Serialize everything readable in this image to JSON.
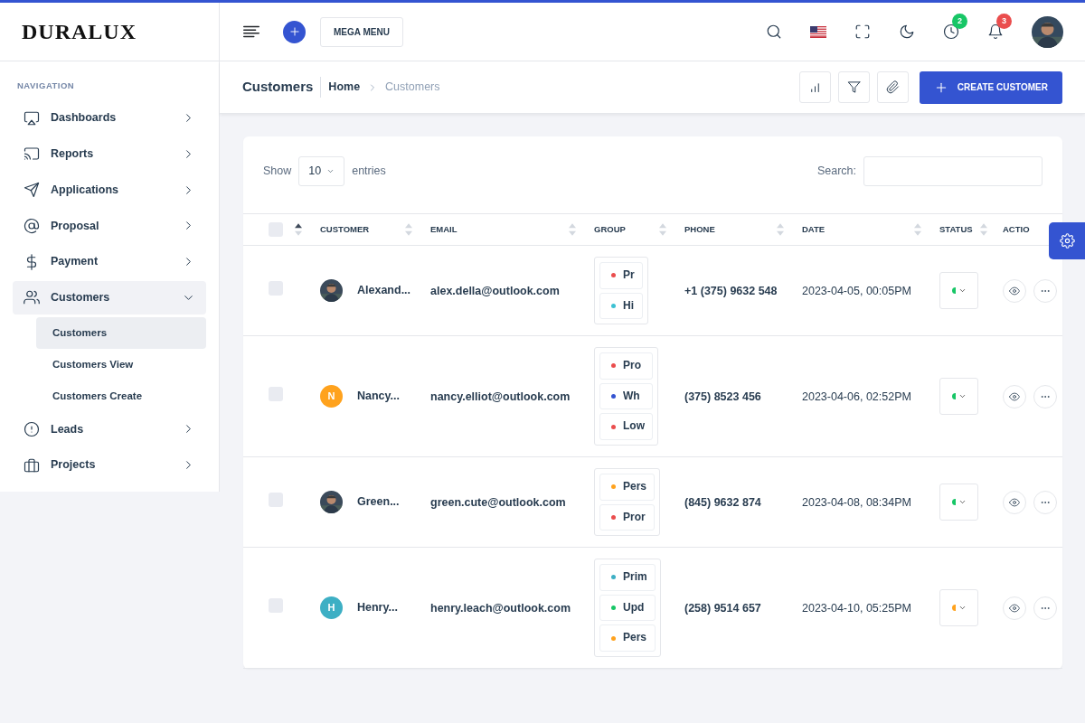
{
  "brand": {
    "logo": "DURALUX"
  },
  "topbar": {
    "mega_menu": "MEGA MENU",
    "badges": [
      {
        "text": "2",
        "color": "#17c666"
      },
      {
        "text": "3",
        "color": "#ea4d4d"
      }
    ]
  },
  "sidebar": {
    "caption": "NAVIGATION",
    "items": [
      {
        "label": "Dashboards",
        "expanded": false
      },
      {
        "label": "Reports",
        "expanded": false
      },
      {
        "label": "Applications",
        "expanded": false
      },
      {
        "label": "Proposal",
        "expanded": false
      },
      {
        "label": "Payment",
        "expanded": false
      },
      {
        "label": "Customers",
        "expanded": true,
        "children": [
          {
            "label": "Customers",
            "selected": true
          },
          {
            "label": "Customers View",
            "selected": false
          },
          {
            "label": "Customers Create",
            "selected": false
          }
        ]
      },
      {
        "label": "Leads",
        "expanded": false
      },
      {
        "label": "Projects",
        "expanded": false
      }
    ]
  },
  "page_header": {
    "title": "Customers",
    "breadcrumb": [
      {
        "label": "Home",
        "current": false
      },
      {
        "label": "Customers",
        "current": true
      }
    ],
    "create_button": "CREATE CUSTOMER"
  },
  "table_controls": {
    "show_label": "Show",
    "page_size": "10",
    "entries_label": "entries",
    "search_label": "Search:"
  },
  "table": {
    "select_all": {
      "checked": false
    },
    "columns": [
      {
        "sortable": true,
        "sorted": true
      },
      {
        "label": "CUSTOMER",
        "sortable": true,
        "sorted": false
      },
      {
        "label": "EMAIL",
        "sortable": true,
        "sorted": false
      },
      {
        "label": "GROUP",
        "sortable": true,
        "sorted": false
      },
      {
        "label": "PHONE",
        "sortable": true,
        "sorted": false
      },
      {
        "label": "DATE",
        "sortable": true,
        "sorted": false
      },
      {
        "label": "STATUS",
        "sortable": true,
        "sorted": false
      },
      {
        "label": "ACTIO",
        "sortable": false
      }
    ],
    "rows": [
      {
        "checked": false,
        "avatar": {
          "kind": "picture"
        },
        "name": "Alexand...",
        "email": "alex.della@outlook.com",
        "groups": [
          {
            "text": "Pr",
            "color": "#ea4d4d"
          },
          {
            "text": "Hi",
            "color": "#3dc1d3"
          }
        ],
        "phone": "+1 (375) 9632 548",
        "date": "2023-04-05, 00:05PM",
        "status": {
          "color": "#17c666"
        }
      },
      {
        "checked": false,
        "avatar": {
          "kind": "initial",
          "text": "N",
          "color": "#ffa21d"
        },
        "name": "Nancy...",
        "email": "nancy.elliot@outlook.com",
        "groups": [
          {
            "text": "Pro",
            "color": "#ea4d4d"
          },
          {
            "text": "Wh",
            "color": "#3454d1"
          },
          {
            "text": "Low",
            "color": "#ea4d4d"
          }
        ],
        "phone": "(375) 8523 456",
        "date": "2023-04-06, 02:52PM",
        "status": {
          "color": "#17c666"
        }
      },
      {
        "checked": false,
        "avatar": {
          "kind": "picture"
        },
        "name": "Green...",
        "email": "green.cute@outlook.com",
        "groups": [
          {
            "text": "Pers",
            "color": "#ffa21d"
          },
          {
            "text": "Pror",
            "color": "#ea4d4d"
          }
        ],
        "phone": "(845) 9632 874",
        "date": "2023-04-08, 08:34PM",
        "status": {
          "color": "#17c666"
        }
      },
      {
        "checked": false,
        "avatar": {
          "kind": "initial",
          "text": "H",
          "color": "#3dafc4"
        },
        "name": "Henry...",
        "email": "henry.leach@outlook.com",
        "groups": [
          {
            "text": "Prim",
            "color": "#3dafc4"
          },
          {
            "text": "Upd",
            "color": "#17c666"
          },
          {
            "text": "Pers",
            "color": "#ffa21d"
          }
        ],
        "phone": "(258) 9514 657",
        "date": "2023-04-10, 05:25PM",
        "status": {
          "color": "#ffa21d"
        }
      }
    ]
  }
}
